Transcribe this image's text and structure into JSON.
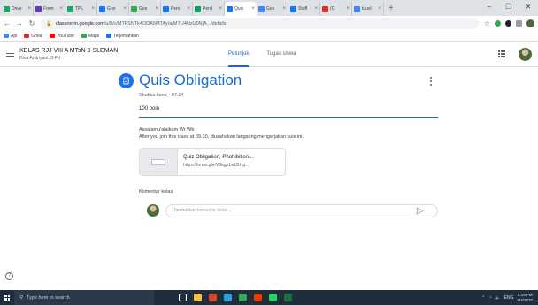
{
  "browser": {
    "tabs": [
      {
        "label": "Drive",
        "color": "#1fa463"
      },
      {
        "label": "Form",
        "color": "#673ab7"
      },
      {
        "label": "TPL",
        "color": "#1fa463"
      },
      {
        "label": "Goo",
        "color": "#1a73e8"
      },
      {
        "label": "Goo",
        "color": "#34a853"
      },
      {
        "label": "Peni",
        "color": "#1a73e8"
      },
      {
        "label": "Penil",
        "color": "#0f9d58"
      },
      {
        "label": "Quis",
        "color": "#1a73e8",
        "active": true
      },
      {
        "label": "Goo",
        "color": "#4285f4"
      },
      {
        "label": "Stuff",
        "color": "#1a73e8"
      },
      {
        "label": "(C",
        "color": "#d93025"
      },
      {
        "label": "tuusl",
        "color": "#4285f4"
      }
    ],
    "new_tab": "+",
    "url_host": "classroom.google.com",
    "url_path": "/u/0/c/MTFSNTk4ODA5MTAy/a/MTU4NzU0NjA.../details",
    "bookmarks": [
      {
        "label": "Apl",
        "color": "#4285f4"
      },
      {
        "label": "Gmail",
        "color": "#d93025"
      },
      {
        "label": "YouTube",
        "color": "#ff0000"
      },
      {
        "label": "Maps",
        "color": "#34a853"
      },
      {
        "label": "Terjemahkan",
        "color": "#1a73e8"
      }
    ]
  },
  "classroom": {
    "class_name": "KELAS RJJ VIII A MTsN 9 SLEMAN",
    "teacher": "Dina Andriyani, S.Pd",
    "tabs": [
      {
        "label": "Petunjuk",
        "active": true
      },
      {
        "label": "Tugas siswa",
        "active": false
      }
    ]
  },
  "assignment": {
    "title": "Quis Obligation",
    "meta": "Shafika Ilana • 07.14",
    "points": "100 poin",
    "greeting": "Assalamu'alaikum Wr Wb",
    "instructions": "After you join this class at 09.30, diusahakan langsung mengerjakan kuis ini.",
    "attachment": {
      "title": "Quiz Obligation, Phohibition...",
      "url": "https://forms.gle/V3kgp1w1BHg..."
    },
    "comments_label": "Komentar kelas",
    "comment_placeholder": "Tambahkan komentar kelas..."
  },
  "taskbar": {
    "search_placeholder": "Type here to search",
    "apps": [
      {
        "name": "task-view",
        "color": "#ffffff"
      },
      {
        "name": "file-explorer",
        "color": "#f2c14e"
      },
      {
        "name": "powerpoint",
        "color": "#d24726"
      },
      {
        "name": "edge",
        "color": "#2b9fd8"
      },
      {
        "name": "chrome",
        "color": "#34a853"
      },
      {
        "name": "office",
        "color": "#eb3c00"
      },
      {
        "name": "whatsapp",
        "color": "#25d366"
      },
      {
        "name": "excel",
        "color": "#1d6f42"
      }
    ],
    "lang": "ENG",
    "time": "5:19 PM",
    "date": "6/4/2020"
  },
  "colors": {
    "accent": "#1967d2",
    "taskbar": "#1f2d3d"
  }
}
